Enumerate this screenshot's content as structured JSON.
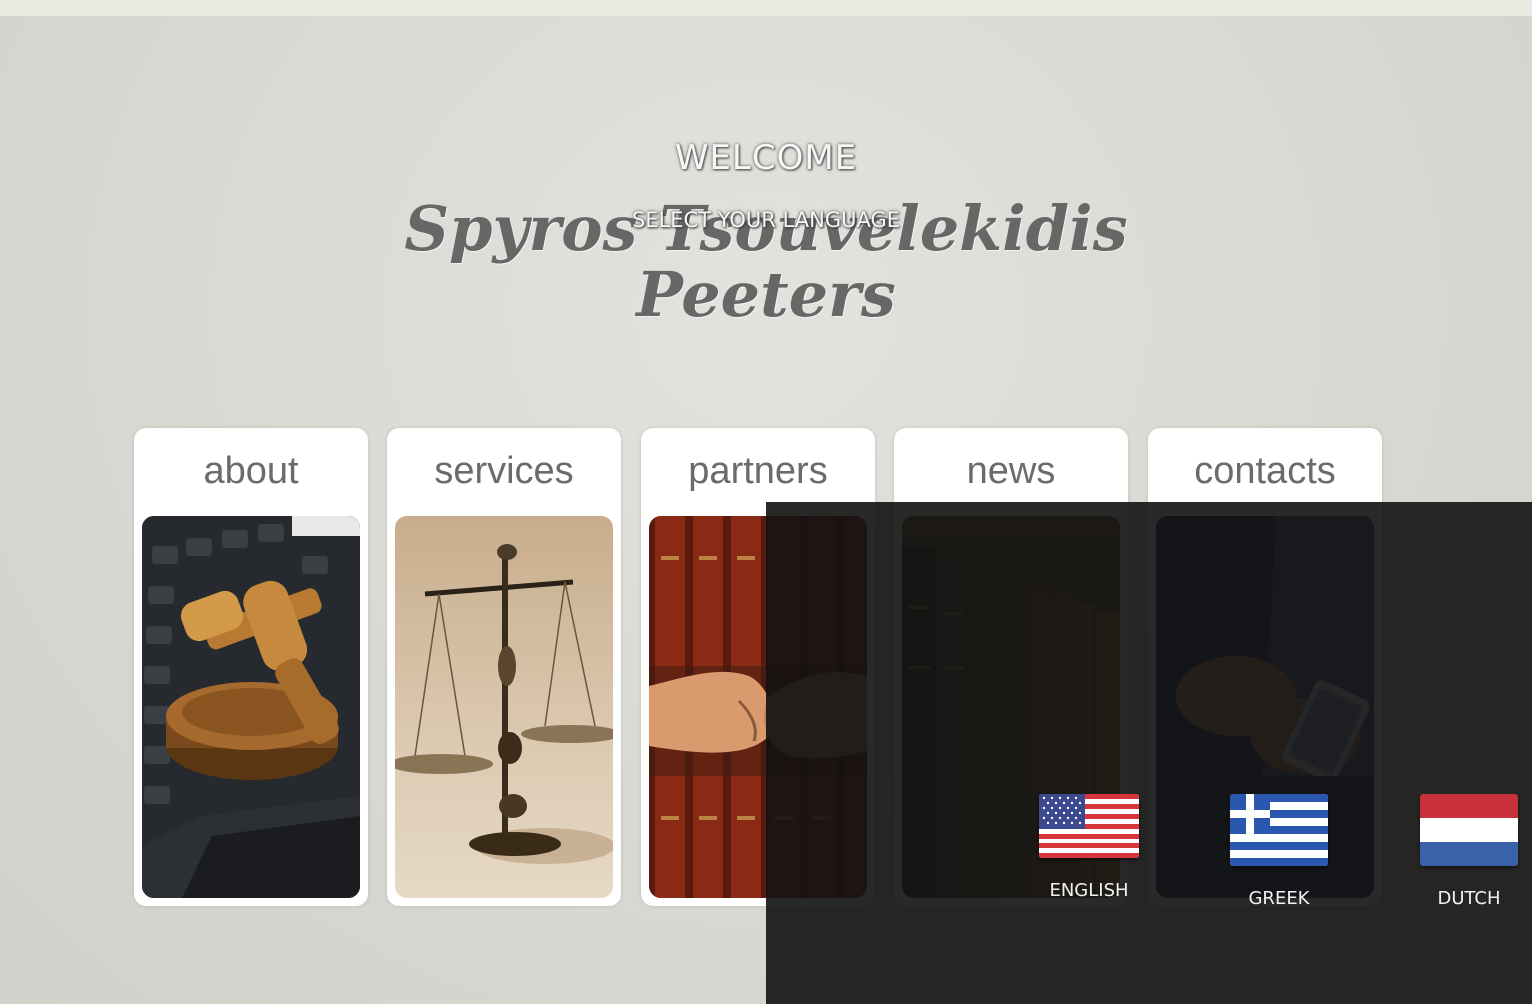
{
  "header": {
    "welcome": "WELCOME",
    "brand_line1": "Spyros Tsouvelekidis",
    "brand_line2": "Peeters",
    "select_language": "SELECT YOUR LANGUAGE"
  },
  "nav": {
    "items": [
      {
        "label": "about",
        "image": "gavel-on-laptop"
      },
      {
        "label": "services",
        "image": "scales-of-justice"
      },
      {
        "label": "partners",
        "image": "handshake"
      },
      {
        "label": "news",
        "image": "law-books"
      },
      {
        "label": "contacts",
        "image": "person-with-phone"
      }
    ]
  },
  "languages": [
    {
      "label": "ENGLISH",
      "flag": "us-flag"
    },
    {
      "label": "GREEK",
      "flag": "greek-flag"
    },
    {
      "label": "DUTCH",
      "flag": "dutch-flag"
    }
  ],
  "colors": {
    "background": "#d9dbd4",
    "overlay": "#121212",
    "card": "#ffffff",
    "label": "#6b6b6b"
  }
}
